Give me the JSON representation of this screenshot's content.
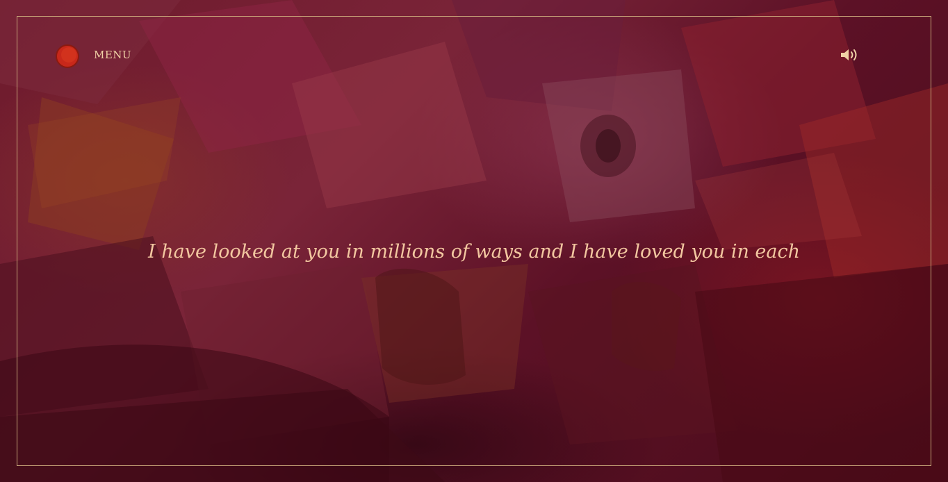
{
  "header": {
    "menu_label": "MENU",
    "logo_icon": "red-circle-logo-icon",
    "sound_icon": "speaker-volume-icon"
  },
  "main": {
    "quote": "I have looked at you in millions of ways and I have loved you in each"
  },
  "colors": {
    "frame_border": "#c9a77a",
    "text": "#f2c7a0",
    "logo_red": "#c8281a",
    "background": "#5a1022"
  }
}
